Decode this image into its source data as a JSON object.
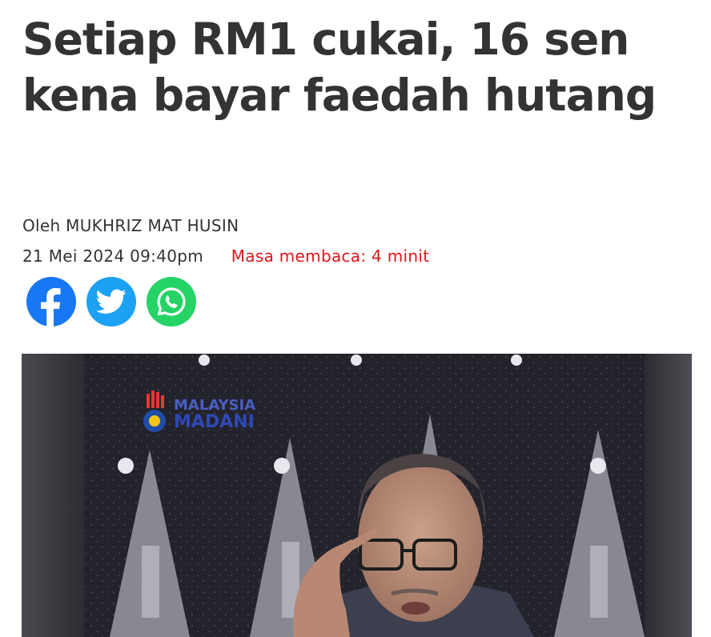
{
  "article": {
    "headline": "Setiap RM1 cukai, 16 sen kena bayar faedah hutang",
    "byline": "Oleh MUKHRIZ MAT HUSIN",
    "date": "21 Mei 2024 09:40pm",
    "reading_time": "Masa membaca: 4 minit"
  },
  "share": {
    "icons": [
      "facebook-icon",
      "twitter-icon",
      "whatsapp-icon"
    ],
    "colors": {
      "facebook": "#1877f2",
      "twitter": "#1da1f2",
      "whatsapp": "#25d366"
    }
  },
  "hero": {
    "logo_text_1": "MALAYSIA",
    "logo_text_2": "MADANI"
  },
  "colors": {
    "text": "#333333",
    "reading_time": "#e0161b"
  }
}
